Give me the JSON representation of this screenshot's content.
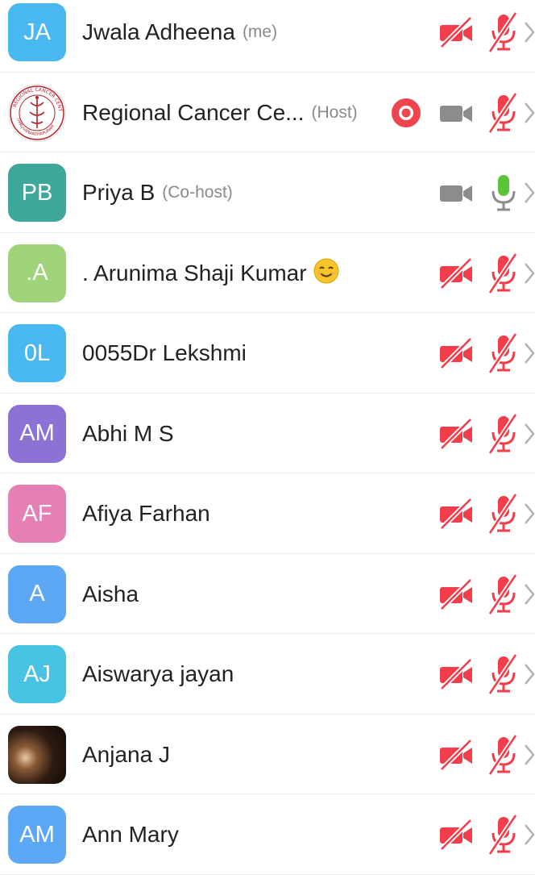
{
  "participants": [
    {
      "initials": "JA",
      "name": "Jwala Adheena",
      "role": "(me)",
      "avatar_color": "#4ab8f0",
      "avatar_type": "initials",
      "video": "off",
      "audio": "muted",
      "recording": false
    },
    {
      "initials": "",
      "name": "Regional Cancer Ce...",
      "role": "(Host)",
      "avatar_color": "#ffffff",
      "avatar_type": "logo",
      "logo_text": "REGIONAL CANCER CENTRE · THIRUVANANTHAPURAM",
      "video": "on",
      "audio": "muted",
      "recording": true
    },
    {
      "initials": "PB",
      "name": "Priya B",
      "role": "(Co-host)",
      "avatar_color": "#3fa89a",
      "avatar_type": "initials",
      "video": "on",
      "audio": "active",
      "recording": false
    },
    {
      "initials": ".A",
      "name": ". Arunima Shaji Kumar",
      "role": "",
      "emoji": "smiling-face",
      "avatar_color": "#9fd47a",
      "avatar_type": "initials",
      "video": "off",
      "audio": "muted",
      "recording": false
    },
    {
      "initials": "0L",
      "name": "0055Dr Lekshmi",
      "role": "",
      "avatar_color": "#4ab8f0",
      "avatar_type": "initials",
      "video": "off",
      "audio": "muted",
      "recording": false
    },
    {
      "initials": "AM",
      "name": "Abhi M S",
      "role": "",
      "avatar_color": "#8d72d6",
      "avatar_type": "initials",
      "video": "off",
      "audio": "muted",
      "recording": false
    },
    {
      "initials": "AF",
      "name": "Afiya Farhan",
      "role": "",
      "avatar_color": "#e67fb3",
      "avatar_type": "initials",
      "video": "off",
      "audio": "muted",
      "recording": false
    },
    {
      "initials": "A",
      "name": "Aisha",
      "role": "",
      "avatar_color": "#5ca8f5",
      "avatar_type": "initials",
      "video": "off",
      "audio": "muted",
      "recording": false
    },
    {
      "initials": "AJ",
      "name": "Aiswarya jayan",
      "role": "",
      "avatar_color": "#48c3e3",
      "avatar_type": "initials",
      "video": "off",
      "audio": "muted",
      "recording": false
    },
    {
      "initials": "",
      "name": "Anjana J",
      "role": "",
      "avatar_color": "#2c1a10",
      "avatar_type": "photo",
      "video": "off",
      "audio": "muted",
      "recording": false
    },
    {
      "initials": "AM",
      "name": "Ann Mary",
      "role": "",
      "avatar_color": "#5ca8f5",
      "avatar_type": "initials",
      "video": "off",
      "audio": "muted",
      "recording": false
    }
  ],
  "colors": {
    "muted_red": "#f23d4b",
    "camera_gray": "#8c8c8c",
    "mic_green": "#5cc43a",
    "record_red": "#f0454f",
    "chevron_gray": "#b0b0b0",
    "name_text": "#222222",
    "role_text": "#8a8a8a"
  },
  "icons": {
    "video_off": "video-off-icon",
    "video_on": "video-camera-icon",
    "mic_muted": "mic-muted-icon",
    "mic_active": "mic-active-icon",
    "recording": "recording-icon",
    "chevron": "chevron-right-icon",
    "emoji": "smiling-face-emoji"
  }
}
